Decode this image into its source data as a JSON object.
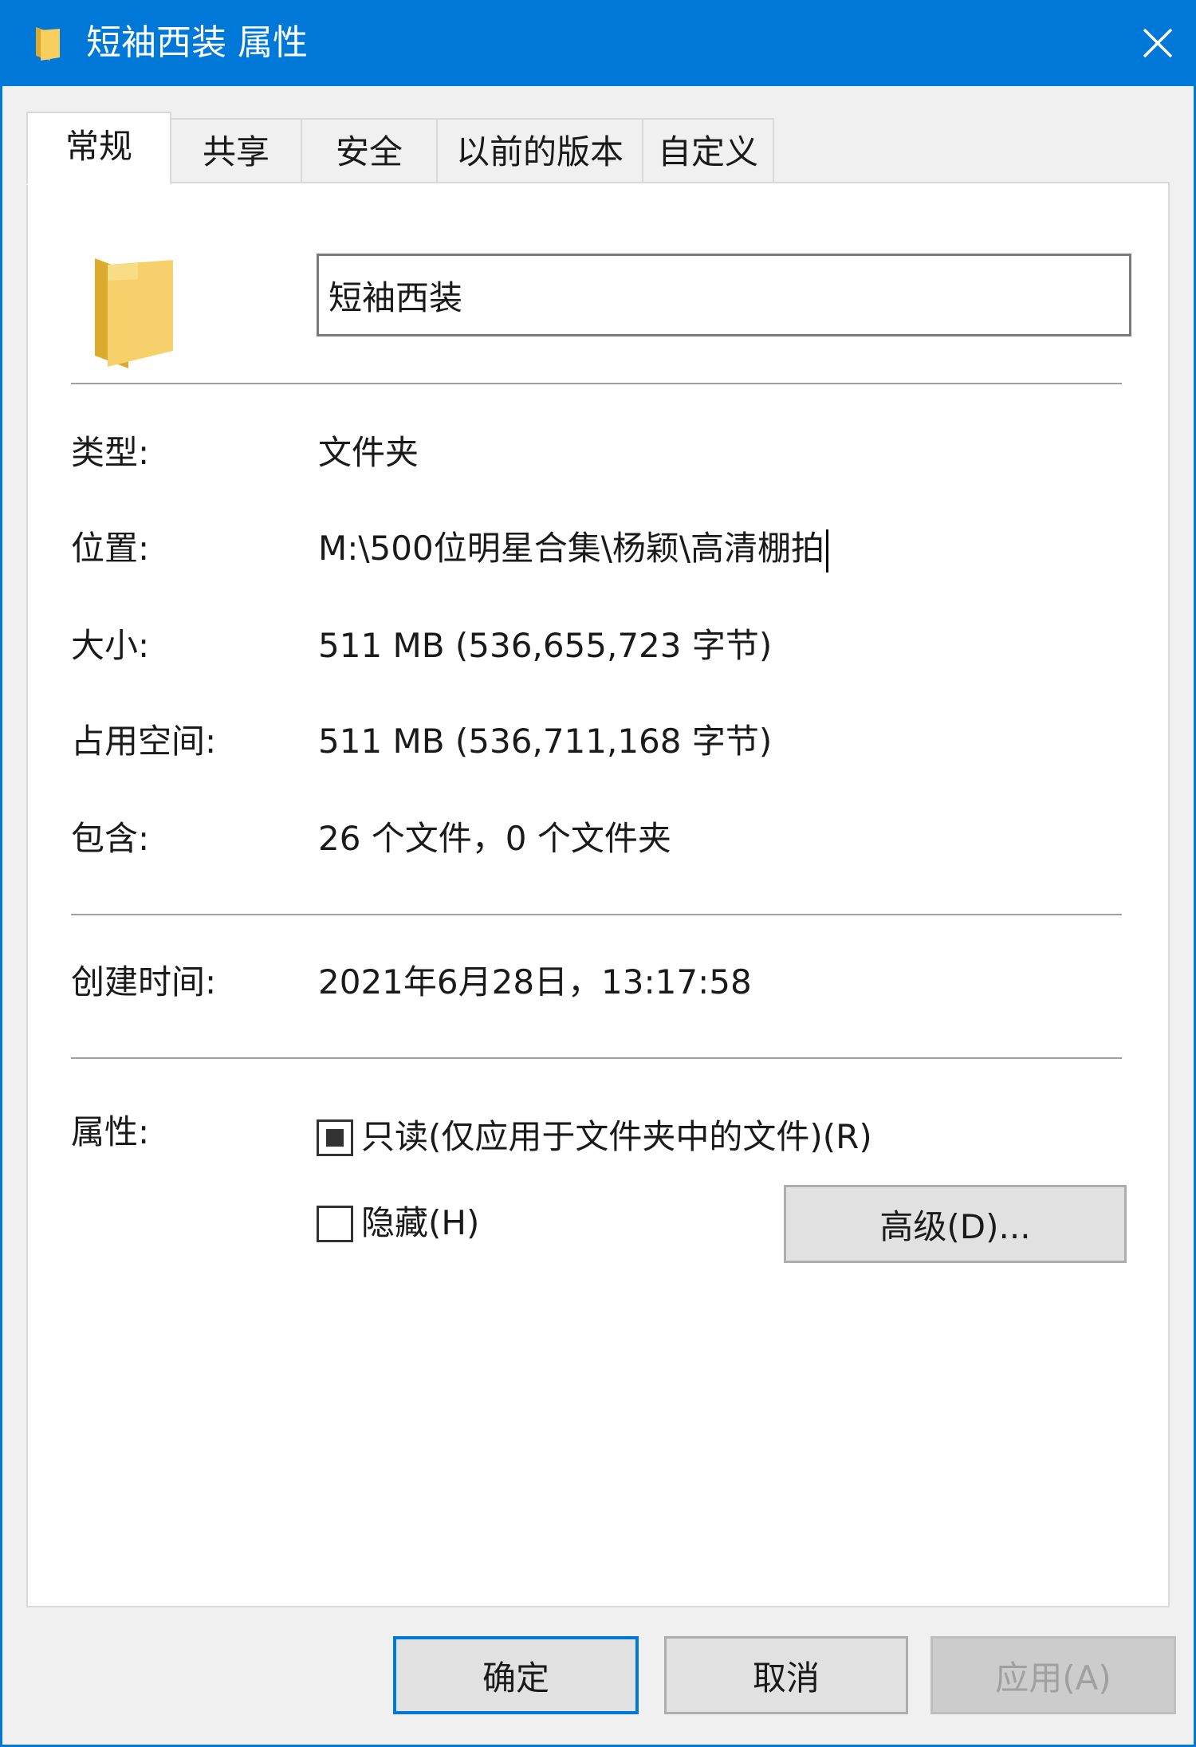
{
  "window": {
    "title": "短袖西装 属性",
    "close_glyph": "✕"
  },
  "tabs": [
    {
      "label": "常规",
      "active": true
    },
    {
      "label": "共享",
      "active": false
    },
    {
      "label": "安全",
      "active": false
    },
    {
      "label": "以前的版本",
      "active": false
    },
    {
      "label": "自定义",
      "active": false
    }
  ],
  "general": {
    "folder_name": "短袖西装",
    "type_label": "类型:",
    "type_value": "文件夹",
    "location_label": "位置:",
    "location_value": "M:\\500位明星合集\\杨颖\\高清棚拍",
    "size_label": "大小:",
    "size_value": "511 MB (536,655,723 字节)",
    "disk_size_label": "占用空间:",
    "disk_size_value": "511 MB (536,711,168 字节)",
    "contains_label": "包含:",
    "contains_value": "26 个文件，0 个文件夹",
    "created_label": "创建时间:",
    "created_value": "2021年6月28日，13:17:58",
    "attributes_label": "属性:",
    "readonly_label": "只读(仅应用于文件夹中的文件)(R)",
    "readonly_state": "indeterminate",
    "hidden_label": "隐藏(H)",
    "hidden_state": "unchecked",
    "advanced_button": "高级(D)..."
  },
  "footer": {
    "ok": "确定",
    "cancel": "取消",
    "apply": "应用(A)"
  },
  "colors": {
    "titlebar": "#0078d7",
    "folder": "#f4c54c",
    "folder_dark": "#dcaa2e"
  }
}
